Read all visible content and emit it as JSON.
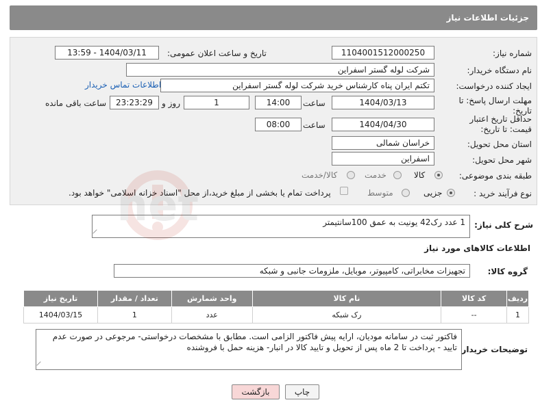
{
  "page_title": "جزئیات اطلاعات نیاز",
  "fields": {
    "need_number_label": "شماره نیاز:",
    "need_number": "1104001512000250",
    "announce_label": "تاریخ و ساعت اعلان عمومی:",
    "announce_value": "1404/03/11 - 13:59",
    "buyer_org_label": "نام دستگاه خریدار:",
    "buyer_org": "شرکت لوله گستر اسفراین",
    "creator_label": "ایجاد کننده درخواست:",
    "creator": "تکتم ایران پناه کارشناس خرید شرکت لوله گستر اسفراین",
    "contact_link": "اطلاعات تماس خریدار",
    "deadline_label": "مهلت ارسال پاسخ: تا تاریخ:",
    "deadline_date": "1404/03/13",
    "time_word": "ساعت",
    "deadline_time": "14:00",
    "days_count": "1",
    "days_and": "روز و",
    "remaining_time": "23:23:29",
    "remaining_label": "ساعت باقی مانده",
    "validity_label": "حداقل تاریخ اعتبار قیمت: تا تاریخ:",
    "validity_date": "1404/04/30",
    "validity_time": "08:00",
    "province_label": "استان محل تحویل:",
    "province": "خراسان شمالی",
    "city_label": "شهر محل تحویل:",
    "city": "اسفراین",
    "category_label": "طبقه بندی موضوعی:",
    "category_options": [
      "کالا",
      "خدمت",
      "کالا/خدمت"
    ],
    "process_label": "نوع فرآیند خرید :",
    "process_options": [
      "جزیی",
      "متوسط"
    ],
    "payment_note": "پرداخت تمام یا بخشی از مبلغ خرید،از محل \"اسناد خزانه اسلامی\" خواهد بود."
  },
  "description": {
    "label": "شرح کلی نیاز:",
    "text": "1 عدد رک42 یونیت به عمق 100سانتیمتر"
  },
  "goods_info_title": "اطلاعات کالاهای مورد نیاز",
  "goods_group": {
    "label": "گروه کالا:",
    "value": "تجهیزات مخابراتی، کامپیوتر، موبایل، ملزومات جانبی و شبکه"
  },
  "table": {
    "headers": [
      "ردیف",
      "کد کالا",
      "نام کالا",
      "واحد شمارش",
      "تعداد / مقدار",
      "تاریخ نیاز"
    ],
    "rows": [
      [
        "1",
        "--",
        "رک شبکه",
        "عدد",
        "1",
        "1404/03/15"
      ]
    ]
  },
  "buyer_notes": {
    "label": "توضیحات خریدار:",
    "text": "فاکتور ثبت در سامانه مودیان، ارایه پیش فاکتور الزامی است. مطابق با مشخصات درخواستی- مرجوعی در صورت عدم تایید - پرداخت تا 2 ماه پس از تحویل و تایید کالا در انبار- هزینه حمل با فروشنده"
  },
  "buttons": {
    "print": "چاپ",
    "back": "بازگشت"
  },
  "colors": {
    "header": "#8a8a8a",
    "link": "#1a5fb4",
    "back_button": "#f8d7d7"
  }
}
